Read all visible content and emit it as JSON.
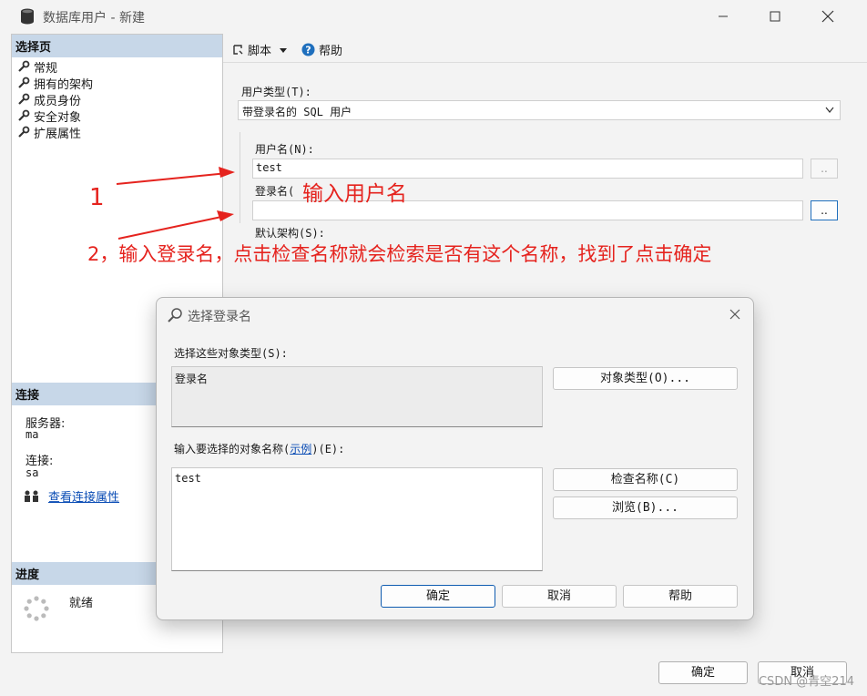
{
  "window": {
    "title": "数据库用户 - 新建"
  },
  "sidebar": {
    "header": "选择页",
    "items": [
      {
        "label": "常规"
      },
      {
        "label": "拥有的架构"
      },
      {
        "label": "成员身份"
      },
      {
        "label": "安全对象"
      },
      {
        "label": "扩展属性"
      }
    ],
    "connection": {
      "header": "连接",
      "server_label": "服务器:",
      "server_value": "ma",
      "conn_label": "连接:",
      "conn_value": "sa",
      "view_link": "查看连接属性"
    },
    "progress": {
      "header": "进度",
      "status": "就绪"
    }
  },
  "toolbar": {
    "script_label": "脚本",
    "help_label": "帮助"
  },
  "form": {
    "user_type_label": "用户类型(T):",
    "user_type_value": "带登录名的 SQL 用户",
    "username_label": "用户名(N):",
    "username_value": "test",
    "login_label": "登录名(",
    "login_value": "",
    "default_schema_label": "默认架构(S):",
    "browse_label": ".."
  },
  "annotations": {
    "step1_num": "1",
    "step1_text": "输入用户名",
    "step2_text": "2，输入登录名，点击检查名称就会检索是否有这个名称，找到了点击确定"
  },
  "dialog": {
    "title": "选择登录名",
    "object_types_label": "选择这些对象类型(S):",
    "object_types_value": "登录名",
    "object_types_button": "对象类型(O)...",
    "enter_names_prefix": "输入要选择的对象名称(",
    "enter_names_link": "示例",
    "enter_names_suffix": ")(E):",
    "names_value": "test",
    "check_names_button": "检查名称(C)",
    "browse_button": "浏览(B)...",
    "ok_button": "确定",
    "cancel_button": "取消",
    "help_button": "帮助"
  },
  "footer": {
    "ok_button": "确定",
    "cancel_button": "取消",
    "watermark": "CSDN @青空214"
  },
  "colors": {
    "annotation": "#e5231e",
    "pane_header": "#c7d7e8",
    "link": "#0b4db5"
  }
}
